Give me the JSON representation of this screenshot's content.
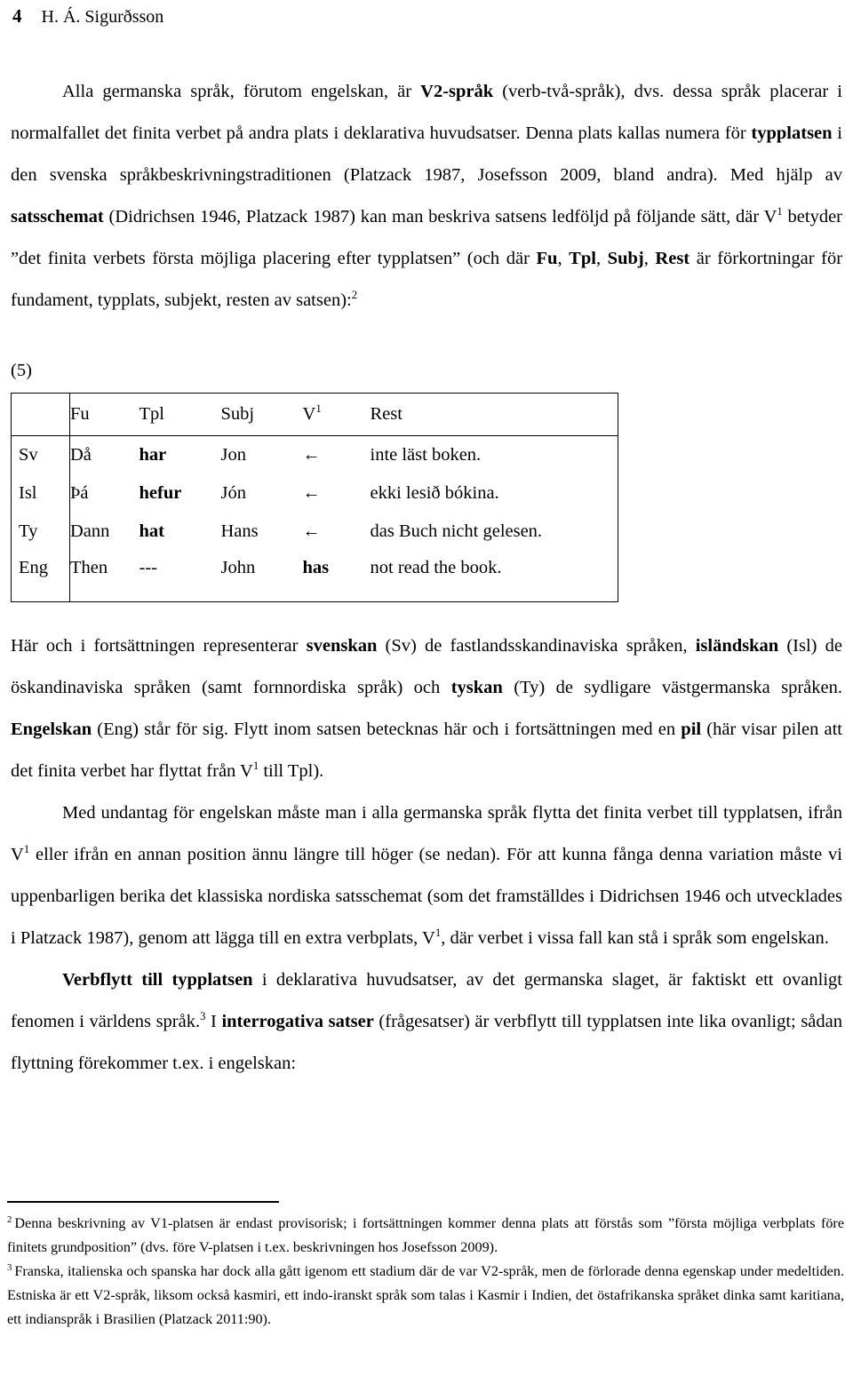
{
  "running_head": {
    "page_number": "4",
    "author": "H. Á. Sigurðsson"
  },
  "paragraphs": {
    "p1_part1": "Alla germanska språk, förutom engelskan, är ",
    "p1_bold1": "V2-språk",
    "p1_part2": " (verb-två-språk), dvs. dessa språk placerar i normalfallet det finita verbet på andra plats i deklarativa huvudsatser. Denna plats kallas numera för ",
    "p1_bold2": "typplatsen",
    "p1_part3": " i den svenska språkbeskrivningstraditionen (Platzack 1987, Josefsson 2009, bland andra). Med hjälp av ",
    "p1_bold3": "satsschemat",
    "p1_part4": " (Didrichsen 1946, Platzack 1987) kan man beskriva satsens ledföljd på följande sätt, där V",
    "p1_sup1": "1",
    "p1_part5": " betyder ”det finita verbets första möjliga placering efter typplatsen” (och där ",
    "p1_bold4": "Fu",
    "p1_part6": ", ",
    "p1_bold5": "Tpl",
    "p1_part7": ", ",
    "p1_bold6": "Subj",
    "p1_part8": ", ",
    "p1_bold7": "Rest",
    "p1_part9": " är förkortningar för fundament, typplats, subjekt, resten av satsen):",
    "p1_sup2": "2",
    "p2_part1": "Här och i fortsättningen representerar ",
    "p2_bold1": "svenskan",
    "p2_part2": " (Sv) de fastlandsskandinaviska språken, ",
    "p2_bold2": "isländskan",
    "p2_part3": " (Isl) de öskandinaviska språken (samt fornnordiska språk) och ",
    "p2_bold3": "tyskan",
    "p2_part4": " (Ty) de sydligare västgermanska språken. ",
    "p2_bold4": "Engelskan",
    "p2_part5": " (Eng) står för sig. Flytt inom satsen betecknas här och i fortsättningen med en ",
    "p2_bold5": "pil",
    "p2_part6": " (här visar pilen att det finita verbet har flyttat från V",
    "p2_sup1": "1",
    "p2_part7": " till Tpl).",
    "p3_part1": "Med undantag för engelskan måste man i alla germanska språk flytta det finita verbet till typplatsen, ifrån V",
    "p3_sup1": "1",
    "p3_part2": " eller ifrån en annan position ännu längre till höger (se nedan). För att kunna fånga denna variation måste vi uppenbarligen berika det klassiska nordiska satsschemat (som det framställdes i Didrichsen 1946 och utvecklades i Platzack 1987), genom att lägga till en extra verbplats, V",
    "p3_sup2": "1",
    "p3_part3": ", där verbet i vissa fall kan stå i språk som engelskan.",
    "p4_bold1": "Verbflytt till typplatsen",
    "p4_part1": " i deklarativa huvudsatser, av det germanska slaget, är faktiskt ett ovanligt fenomen i världens språk.",
    "p4_sup1": "3",
    "p4_part2": " I ",
    "p4_bold2": "interrogativa satser",
    "p4_part3": " (frågesatser) är verbflytt till typplatsen inte lika ovanligt; sådan flyttning förekommer t.ex. i engelskan:"
  },
  "example": {
    "number": "(5)",
    "columns": [
      "",
      "Fu",
      "Tpl",
      "Subj",
      "V",
      "Rest"
    ],
    "v1_superscript": "1",
    "rows": [
      {
        "lang": "Sv",
        "fu": "Då",
        "tpl": "har",
        "subj": "Jon",
        "v1": "←",
        "rest": "inte läst boken."
      },
      {
        "lang": "Isl",
        "fu": "Þá",
        "tpl": "hefur",
        "subj": "Jón",
        "v1": "←",
        "rest": "ekki lesið bókina."
      },
      {
        "lang": "Ty",
        "fu": "Dann",
        "tpl": "hat",
        "subj": "Hans",
        "v1": "←",
        "rest": "das Buch nicht gelesen."
      },
      {
        "lang": "Eng",
        "fu": "Then",
        "tpl": "---",
        "subj": "John",
        "v1": "has",
        "rest": "not read the book."
      }
    ]
  },
  "footnotes": [
    {
      "marker": "2",
      "text": "Denna beskrivning av V1-platsen är endast provisorisk; i fortsättningen kommer denna plats att förstås som ”första möjliga verbplats före finitets grundposition” (dvs. före V-platsen i t.ex. beskrivningen hos Josefsson 2009)."
    },
    {
      "marker": "3",
      "text": "Franska, italienska och spanska har dock alla gått igenom ett stadium där de var V2-språk, men de förlorade denna egenskap under medeltiden. Estniska är ett V2-språk, liksom också  kasmiri, ett indo-iranskt språk som talas i Kasmir i Indien, det östafrikanska språket dinka samt karitiana, ett indianspråk i Brasilien (Platzack 2011:90)."
    }
  ]
}
